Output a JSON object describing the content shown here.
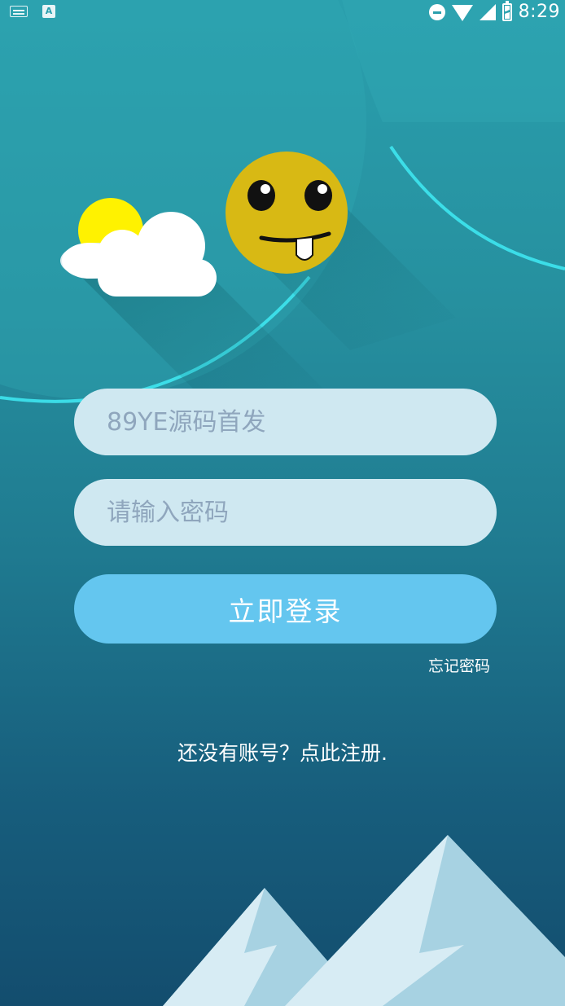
{
  "status_bar": {
    "time": "8:29",
    "left_icons": [
      "keyboard-icon",
      "a-icon"
    ],
    "a_label": "A",
    "right_icons": [
      "do-not-disturb-icon",
      "wifi-icon",
      "signal-icon",
      "battery-icon"
    ]
  },
  "login": {
    "username_placeholder": "89YE源码首发",
    "password_placeholder": "请输入密码",
    "submit_label": "立即登录",
    "forgot_label": "忘记密码",
    "register_label": "还没有账号？点此注册."
  },
  "colors": {
    "background_top": "#2a9fad",
    "background_bottom": "#134d6e",
    "field_bg": "#cfe8f1",
    "button_bg": "#64c6ef",
    "glow_arc": "#3ee6f0",
    "sun": "#fff200",
    "emoji_face": "#d8b914"
  },
  "illustrations": [
    "weather-cloud-sun-icon",
    "smiley-emoji-icon",
    "mountains-illustration"
  ]
}
